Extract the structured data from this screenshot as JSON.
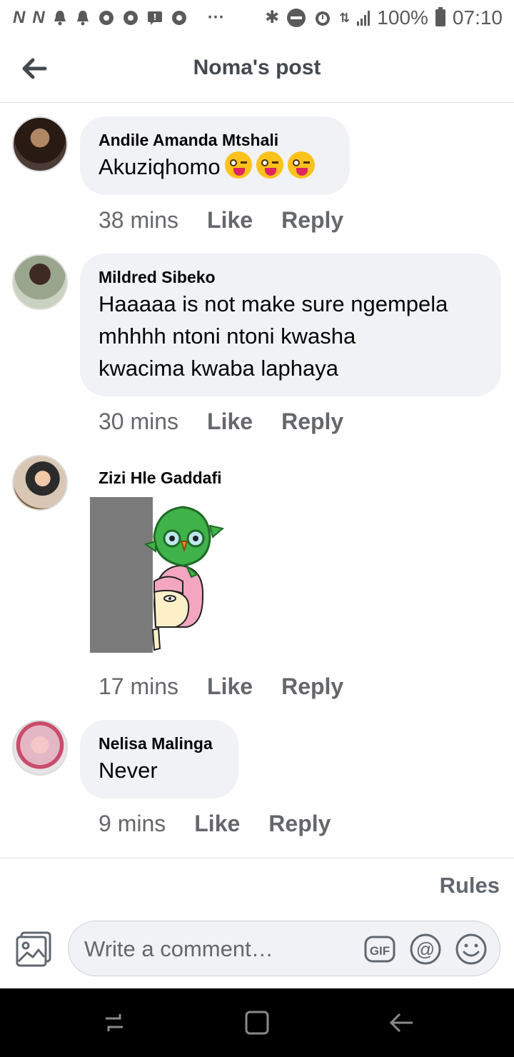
{
  "status_bar": {
    "battery": "100%",
    "time": "07:10",
    "icons": [
      "nfc-icon",
      "nfc-icon",
      "bell-icon",
      "bell-icon",
      "chrome-icon",
      "chrome-icon",
      "message-icon",
      "chrome-icon",
      "more-icon",
      "bluetooth-icon",
      "do-not-disturb-icon",
      "alarm-icon",
      "data-icon",
      "signal-icon",
      "battery-icon"
    ]
  },
  "header": {
    "title": "Noma's post",
    "back_icon": "arrow-left-icon"
  },
  "comments": [
    {
      "author": "Andile Amanda Mtshali",
      "text": "Akuziqhomo",
      "emoji": [
        "winking-face-with-tongue",
        "winking-face-with-tongue",
        "winking-face-with-tongue"
      ],
      "time": "38 mins",
      "like": "Like",
      "reply": "Reply"
    },
    {
      "author": "Mildred Sibeko",
      "text_lines": [
        "Haaaaa is not make sure ngempela",
        "mhhhh ntoni ntoni kwasha",
        "kwacima kwaba laphaya"
      ],
      "time": "30 mins",
      "like": "Like",
      "reply": "Reply"
    },
    {
      "author": "Zizi Hle Gaddafi",
      "sticker": "peeking-girl-with-owl-sticker",
      "time": "17 mins",
      "like": "Like",
      "reply": "Reply"
    },
    {
      "author": "Nelisa Malinga",
      "text": "Never",
      "time": "9 mins",
      "like": "Like",
      "reply": "Reply"
    }
  ],
  "footer": {
    "rules": "Rules",
    "input_placeholder": "Write a comment…",
    "icons": [
      "photo-icon",
      "gif-icon",
      "mention-icon",
      "emoji-icon"
    ]
  },
  "nav_bar": {
    "icons": [
      "recent-apps-icon",
      "home-icon",
      "back-icon"
    ]
  },
  "colors": {
    "bubble": "#f0f2f5",
    "meta": "#65676b",
    "title": "#444950"
  }
}
